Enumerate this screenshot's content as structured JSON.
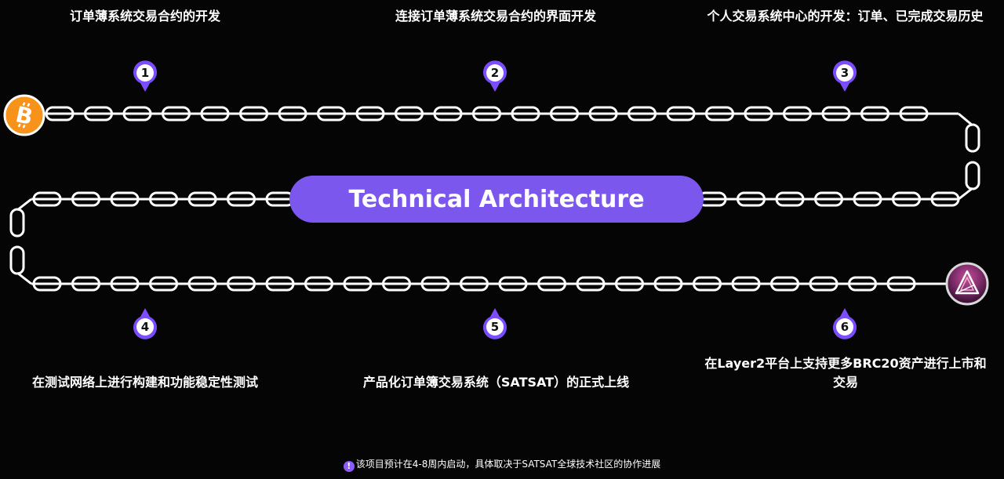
{
  "title": "Technical Architecture",
  "steps": [
    {
      "number": "1",
      "text": "订单薄系统交易合约的开发"
    },
    {
      "number": "2",
      "text": "连接订单薄系统交易合约的界面开发"
    },
    {
      "number": "3",
      "text": "个人交易系统中心的开发：订单、已完成交易历史"
    },
    {
      "number": "4",
      "text": "在测试网络上进行构建和功能稳定性测试"
    },
    {
      "number": "5",
      "text": "产品化订单簿交易系统（SATSAT）的正式上线"
    },
    {
      "number": "6",
      "text": "在Layer2平台上支持更多BRC20资产进行上市和交易"
    }
  ],
  "logos": {
    "start": "bitcoin-logo",
    "end": "satsat-logo"
  },
  "footnote": {
    "icon": "!",
    "text": "该项目预计在4-8周内启动，具体取决于SATSAT全球技术社区的协作进展"
  },
  "colors": {
    "background": "#050505",
    "accent": "#7b57ee",
    "pin": "#7c4dff",
    "bitcoin": "#f7931a"
  }
}
